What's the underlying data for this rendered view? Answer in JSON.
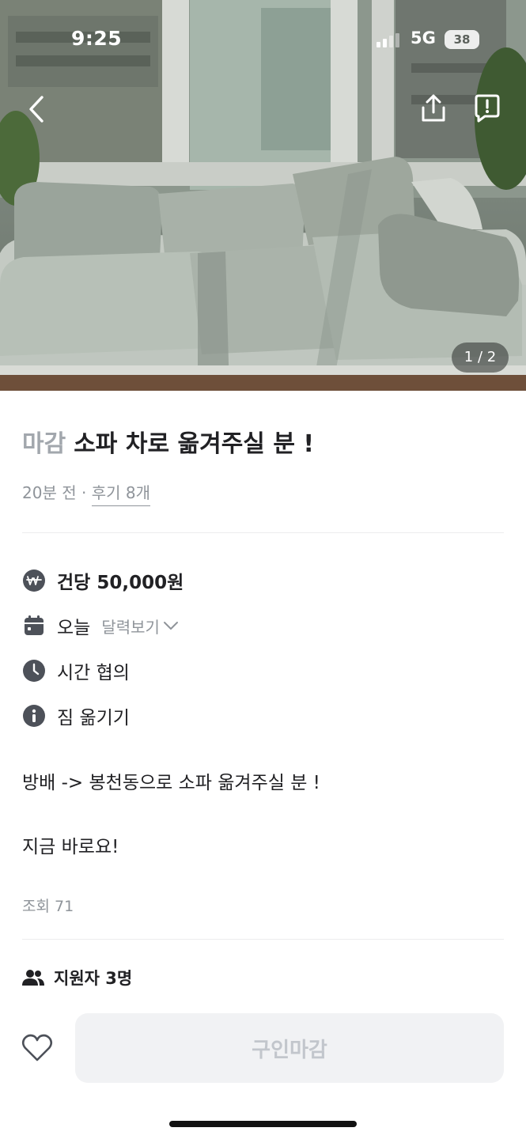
{
  "status_bar": {
    "time": "9:25",
    "network": "5G",
    "battery": "38"
  },
  "gallery": {
    "counter": "1 / 2"
  },
  "post": {
    "status_label": "마감",
    "title": "소파 차로 옮겨주실 분 !",
    "posted": "20분 전",
    "separator": "·",
    "reviews": "후기 8개"
  },
  "details": {
    "price": "건당 50,000원",
    "date": "오늘",
    "calendar_link": "달력보기",
    "time": "시간 협의",
    "category": "짐 옮기기"
  },
  "description": {
    "line1": "방배 -> 봉천동으로 소파 옮겨주실 분 !",
    "line2": "지금 바로요!"
  },
  "stats": {
    "views": "조회 71"
  },
  "applicants": {
    "label": "지원자 3명"
  },
  "cta": {
    "label": "구인마감"
  },
  "icons": {
    "back": "chevron-left-icon",
    "share": "share-icon",
    "report": "report-icon",
    "price": "won-coin-icon",
    "date": "calendar-icon",
    "time": "clock-icon",
    "category": "info-icon",
    "applicants": "people-icon",
    "like": "heart-icon"
  },
  "colors": {
    "text": "#212124",
    "muted": "#8f949a",
    "status_label": "#a2a7ad",
    "cta_bg": "#f1f2f4",
    "cta_text": "#c2c6cc"
  }
}
